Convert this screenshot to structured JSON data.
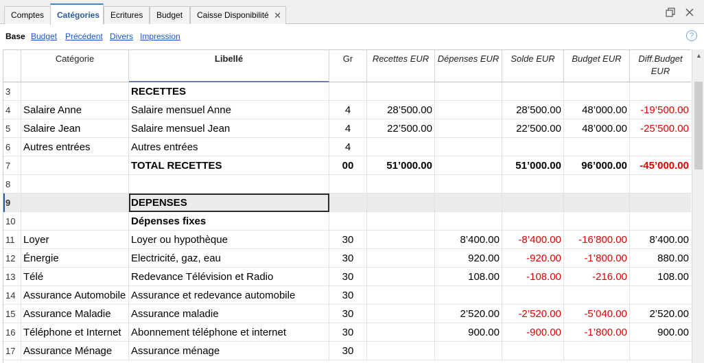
{
  "tabs": [
    {
      "label": "Comptes"
    },
    {
      "label": "Catégories"
    },
    {
      "label": "Ecritures"
    },
    {
      "label": "Budget"
    },
    {
      "label": "Caisse Disponibilité"
    }
  ],
  "subnav": {
    "current": "Base",
    "links": [
      "Budget",
      "Précédent",
      "Divers",
      "Impression"
    ],
    "help": "?"
  },
  "columns": {
    "categorie": "Catégorie",
    "libelle": "Libellé",
    "gr": "Gr",
    "recettes": "Recettes EUR",
    "depenses": "Dépenses EUR",
    "solde": "Solde EUR",
    "budget": "Budget EUR",
    "diff1": "Diff.Budget",
    "diff2": "EUR"
  },
  "rows": [
    {
      "n": "3",
      "cat": "",
      "lib": "RECETTES",
      "gr": "",
      "rec": "",
      "dep": "",
      "sol": "",
      "bud": "",
      "diff": ""
    },
    {
      "n": "4",
      "cat": "Salaire Anne",
      "lib": "Salaire mensuel Anne",
      "gr": "4",
      "rec": "28’500.00",
      "dep": "",
      "sol": "28’500.00",
      "bud": "48’000.00",
      "diff": "-19’500.00"
    },
    {
      "n": "5",
      "cat": "Salaire Jean",
      "lib": "Salaire mensuel Jean",
      "gr": "4",
      "rec": "22’500.00",
      "dep": "",
      "sol": "22’500.00",
      "bud": "48’000.00",
      "diff": "-25’500.00"
    },
    {
      "n": "6",
      "cat": "Autres entrées",
      "lib": "Autres entrées",
      "gr": "4",
      "rec": "",
      "dep": "",
      "sol": "",
      "bud": "",
      "diff": ""
    },
    {
      "n": "7",
      "cat": "",
      "lib": "TOTAL RECETTES",
      "gr": "00",
      "rec": "51’000.00",
      "dep": "",
      "sol": "51’000.00",
      "bud": "96’000.00",
      "diff": "-45’000.00"
    },
    {
      "n": "8",
      "cat": "",
      "lib": "",
      "gr": "",
      "rec": "",
      "dep": "",
      "sol": "",
      "bud": "",
      "diff": ""
    },
    {
      "n": "9",
      "cat": "",
      "lib": "DEPENSES",
      "gr": "",
      "rec": "",
      "dep": "",
      "sol": "",
      "bud": "",
      "diff": ""
    },
    {
      "n": "10",
      "cat": "",
      "lib": "Dépenses fixes",
      "gr": "",
      "rec": "",
      "dep": "",
      "sol": "",
      "bud": "",
      "diff": ""
    },
    {
      "n": "11",
      "cat": "Loyer",
      "lib": "Loyer ou hypothèque",
      "gr": "30",
      "rec": "",
      "dep": "8’400.00",
      "sol": "-8’400.00",
      "bud": "-16’800.00",
      "diff": "8’400.00"
    },
    {
      "n": "12",
      "cat": "Énergie",
      "lib": "Electricité, gaz, eau",
      "gr": "30",
      "rec": "",
      "dep": "920.00",
      "sol": "-920.00",
      "bud": "-1’800.00",
      "diff": "880.00"
    },
    {
      "n": "13",
      "cat": "Télé",
      "lib": "Redevance Télévision et Radio",
      "gr": "30",
      "rec": "",
      "dep": "108.00",
      "sol": "-108.00",
      "bud": "-216.00",
      "diff": "108.00"
    },
    {
      "n": "14",
      "cat": "Assurance Automobile",
      "lib": "Assurance et redevance automobile",
      "gr": "30",
      "rec": "",
      "dep": "",
      "sol": "",
      "bud": "",
      "diff": ""
    },
    {
      "n": "15",
      "cat": "Assurance Maladie",
      "lib": "Assurance maladie",
      "gr": "30",
      "rec": "",
      "dep": "2’520.00",
      "sol": "-2’520.00",
      "bud": "-5’040.00",
      "diff": "2’520.00"
    },
    {
      "n": "16",
      "cat": "Téléphone et Internet",
      "lib": "Abonnement téléphone et internet",
      "gr": "30",
      "rec": "",
      "dep": "900.00",
      "sol": "-900.00",
      "bud": "-1’800.00",
      "diff": "900.00"
    },
    {
      "n": "17",
      "cat": "Assurance Ménage",
      "lib": "Assurance ménage",
      "gr": "30",
      "rec": "",
      "dep": "",
      "sol": "",
      "bud": "",
      "diff": ""
    }
  ],
  "colors": {
    "negative": "#e00000",
    "accent": "#2a5a9b",
    "link": "#1a56c8"
  }
}
